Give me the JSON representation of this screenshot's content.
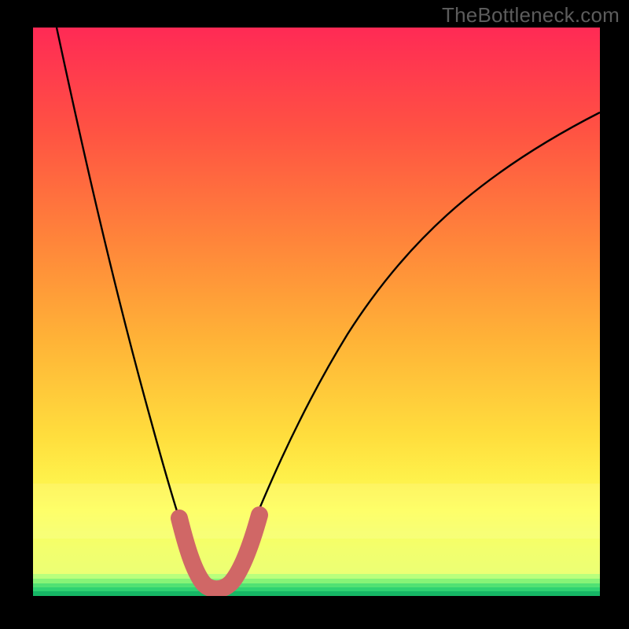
{
  "watermark": "TheBottleneck.com",
  "colors": {
    "black": "#000000",
    "gradient_top": "#ff2a55",
    "gradient_mid1": "#ff6a3a",
    "gradient_mid2": "#ffb337",
    "gradient_mid3": "#ffe63e",
    "gradient_mid4": "#fbff56",
    "gradient_bottom_band": "#e6ff7a",
    "green_band_1": "#aaff78",
    "green_band_2": "#66ef77",
    "green_band_3": "#2fd874",
    "green_band_4": "#17c46e",
    "final_green": "#0fae5f",
    "curve": "#000000",
    "u_shape_fill": "#d06766",
    "u_shape_stroke": "#c45a57"
  },
  "chart_data": {
    "type": "line",
    "title": "",
    "xlabel": "",
    "ylabel": "",
    "xlim": [
      0,
      100
    ],
    "ylim": [
      0,
      100
    ],
    "series": [
      {
        "name": "bottleneck-curve",
        "x": [
          4,
          8,
          12,
          16,
          20,
          24,
          26,
          28,
          30,
          32,
          34,
          38,
          44,
          52,
          60,
          70,
          80,
          90,
          100
        ],
        "y": [
          100,
          80,
          62,
          46,
          32,
          18,
          11,
          6,
          3,
          3,
          7,
          16,
          30,
          44,
          54,
          64,
          72,
          78,
          83
        ]
      }
    ],
    "annotations": {
      "u_shape_region_x": [
        24.5,
        34.5
      ],
      "u_shape_region_y": [
        2,
        12
      ]
    }
  }
}
